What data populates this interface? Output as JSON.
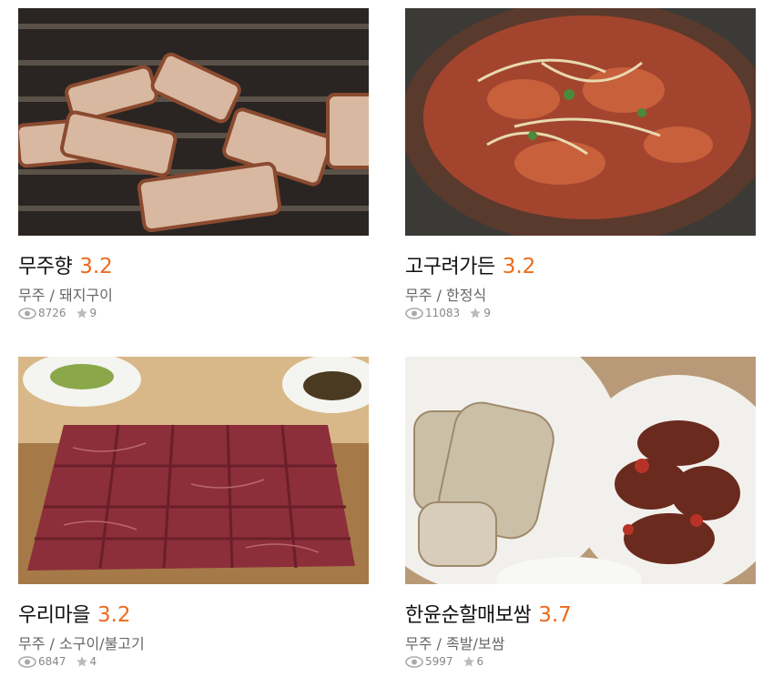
{
  "restaurants": [
    {
      "name": "무주향",
      "rating": "3.2",
      "region": "무주",
      "category": "돼지구이",
      "views": "8726",
      "favorites": "9",
      "photo": "pork-belly-grill"
    },
    {
      "name": "고구려가든",
      "rating": "3.2",
      "region": "무주",
      "category": "한정식",
      "views": "11083",
      "favorites": "9",
      "photo": "spicy-stew-pot"
    },
    {
      "name": "우리마을",
      "rating": "3.2",
      "region": "무주",
      "category": "소구이/불고기",
      "views": "6847",
      "favorites": "4",
      "photo": "raw-beef-board"
    },
    {
      "name": "한윤순할매보쌈",
      "rating": "3.7",
      "region": "무주",
      "category": "족발/보쌈",
      "views": "5997",
      "favorites": "6",
      "photo": "bossam-kimchi"
    }
  ],
  "separator": " / ",
  "colors": {
    "rating": "#ee6a1b",
    "meta": "#666666",
    "stats": "#888888"
  },
  "icons": {
    "views": "eye-icon",
    "favorites": "star-icon"
  }
}
